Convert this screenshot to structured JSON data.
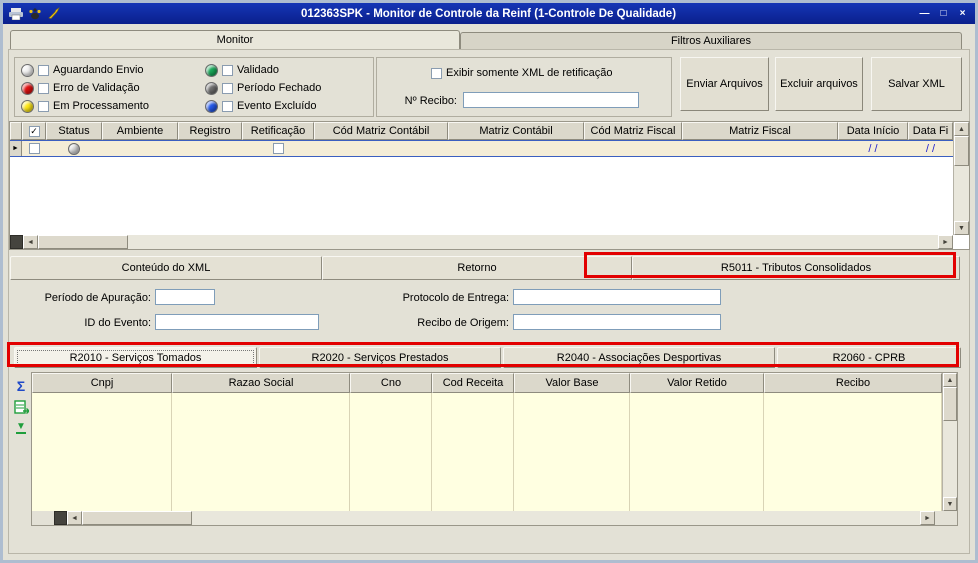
{
  "window": {
    "title": "012363SPK - Monitor de Controle da Reinf (1-Controle De Qualidade)",
    "minimize": "—",
    "maximize": "□",
    "close": "×"
  },
  "main_tabs": {
    "monitor": "Monitor",
    "filtros": "Filtros Auxiliares"
  },
  "legend": {
    "items": [
      {
        "label": "Aguardando Envio",
        "color": "#f2f2f2"
      },
      {
        "label": "Erro de Validação",
        "color": "#e01010"
      },
      {
        "label": "Em Processamento",
        "color": "#ffe818"
      },
      {
        "label": "Validado",
        "color": "#18a858"
      },
      {
        "label": "Período Fechado",
        "color": "#6e6e6e"
      },
      {
        "label": "Evento Excluído",
        "color": "#2458e8"
      }
    ]
  },
  "filter_panel": {
    "xml_retificacao_label": "Exibir somente XML de retificação",
    "recibo_label": "Nº Recibo:",
    "recibo_value": ""
  },
  "actions": {
    "enviar": "Enviar Arquivos",
    "excluir": "Excluir arquivos",
    "salvar": "Salvar XML"
  },
  "grid_monitor": {
    "columns": [
      "Status",
      "Ambiente",
      "Registro",
      "Retificação",
      "Cód Matriz Contábil",
      "Matriz Contábil",
      "Cód Matriz Fiscal",
      "Matriz Fiscal",
      "Data Início",
      "Data Fi"
    ],
    "selected_row": {
      "status_color": "#d7d7d7",
      "data_inicio": "/ /",
      "data_fim": "/ /"
    }
  },
  "detail_tabs": {
    "conteudo_xml": "Conteúdo do XML",
    "retorno": "Retorno",
    "r5011": "R5011 - Tributos Consolidados"
  },
  "detail_form": {
    "periodo_apuracao_label": "Período de Apuração:",
    "periodo_apuracao_value": "",
    "protocolo_entrega_label": "Protocolo de Entrega:",
    "protocolo_entrega_value": "",
    "id_evento_label": "ID do Evento:",
    "id_evento_value": "",
    "recibo_origem_label": "Recibo de Origem:",
    "recibo_origem_value": ""
  },
  "event_tabs": {
    "r2010": "R2010 - Serviços Tomados",
    "r2020": "R2020 - Serviços Prestados",
    "r2040": "R2040 - Associações Desportivas",
    "r2060": "R2060 - CPRB"
  },
  "grid_eventos": {
    "columns": [
      "Cnpj",
      "Razao Social",
      "Cno",
      "Cod Receita",
      "Valor Base",
      "Valor Retido",
      "Recibo"
    ]
  },
  "icons": {
    "check": "✓",
    "row_indicator": "►",
    "scroll_left": "◄",
    "scroll_right": "►",
    "scroll_up": "▲",
    "scroll_down": "▼",
    "sum": "Σ",
    "go_bottom": "▼"
  },
  "colors": {
    "annotation_red": "#e20000",
    "title_bar_blue": "#0f2aa0",
    "grid_cream": "#ffffe1"
  }
}
